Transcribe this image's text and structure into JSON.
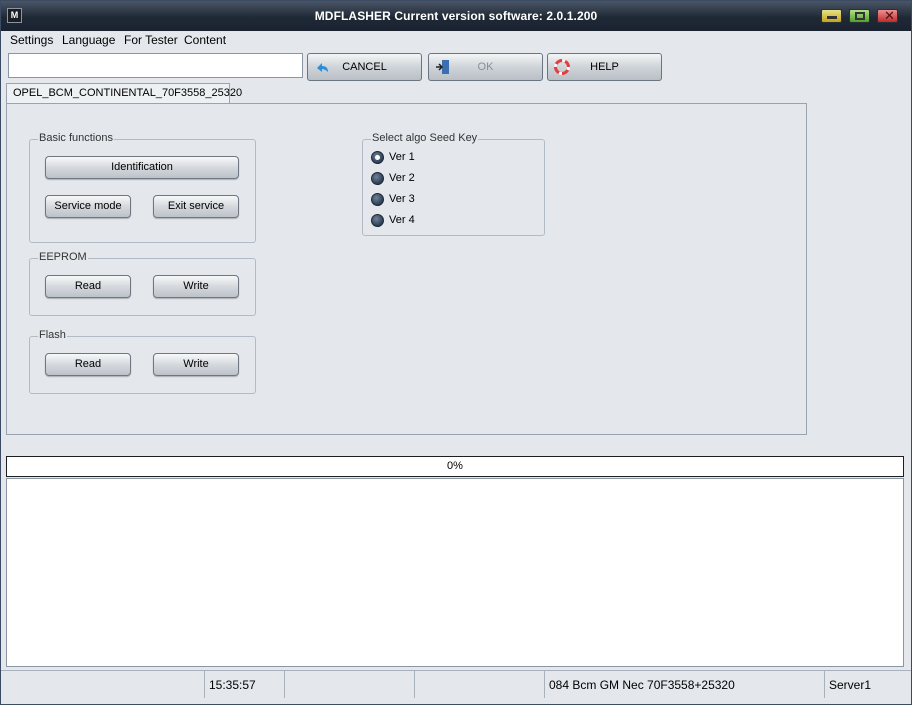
{
  "window": {
    "title": "MDFLASHER  Current version software: 2.0.1.200",
    "icon_label": "M"
  },
  "menu": [
    "Settings",
    "Language",
    "For Tester",
    "Content"
  ],
  "toolbar": {
    "input_value": "",
    "cancel_label": "CANCEL",
    "ok_label": "OK",
    "help_label": "HELP"
  },
  "tab": {
    "label": "OPEL_BCM_CONTINENTAL_70F3558_25320"
  },
  "basic": {
    "title": "Basic functions",
    "identification": "Identification",
    "service_mode": "Service mode",
    "exit_service": "Exit service"
  },
  "eeprom": {
    "title": "EEPROM",
    "read": "Read",
    "write": "Write"
  },
  "flash": {
    "title": "Flash",
    "read": "Read",
    "write": "Write"
  },
  "seed": {
    "title": "Select algo Seed Key",
    "options": [
      "Ver 1",
      "Ver 2",
      "Ver 3",
      "Ver 4"
    ],
    "selected": 0
  },
  "progress": {
    "value": 0,
    "label": "0%"
  },
  "status": {
    "time": "15:35:57",
    "device": "084 Bcm GM Nec 70F3558+25320",
    "server": "Server1"
  },
  "colors": {
    "titlebar": "#1f2936",
    "progress_fill": "#3a7bd5"
  }
}
